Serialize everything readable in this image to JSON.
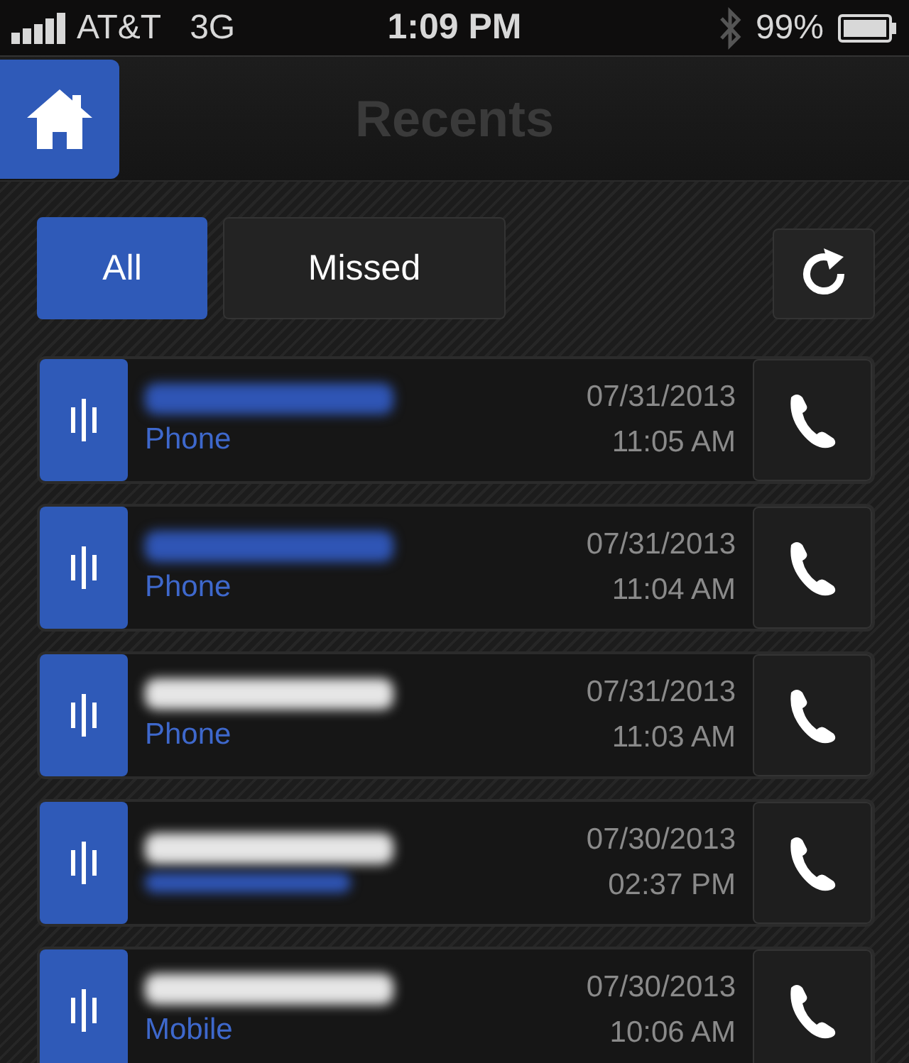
{
  "status_bar": {
    "carrier": "AT&T",
    "network": "3G",
    "time": "1:09 PM",
    "battery": "99%"
  },
  "nav_bar": {
    "title": "Recents"
  },
  "filters": [
    {
      "label": "All",
      "selected": true
    },
    {
      "label": "Missed",
      "selected": false
    }
  ],
  "calls": [
    {
      "color": "#2f55b5",
      "type": "Phone",
      "date": "07/31/2013",
      "time": "11:05 AM"
    },
    {
      "color": "#2f55b5",
      "type": "Phone",
      "date": "07/31/2013",
      "time": "11:04 AM"
    },
    {
      "color": "#e6e6e6",
      "type": "Phone",
      "date": "07/31/2013",
      "time": "11:03 AM"
    },
    {
      "color": "#e6e6e6",
      "type_redacted": true,
      "date": "07/30/2013",
      "time": "02:37 PM"
    },
    {
      "color": "#e6e6e6",
      "type": "Mobile",
      "date": "07/30/2013",
      "time": "10:06 AM"
    }
  ]
}
